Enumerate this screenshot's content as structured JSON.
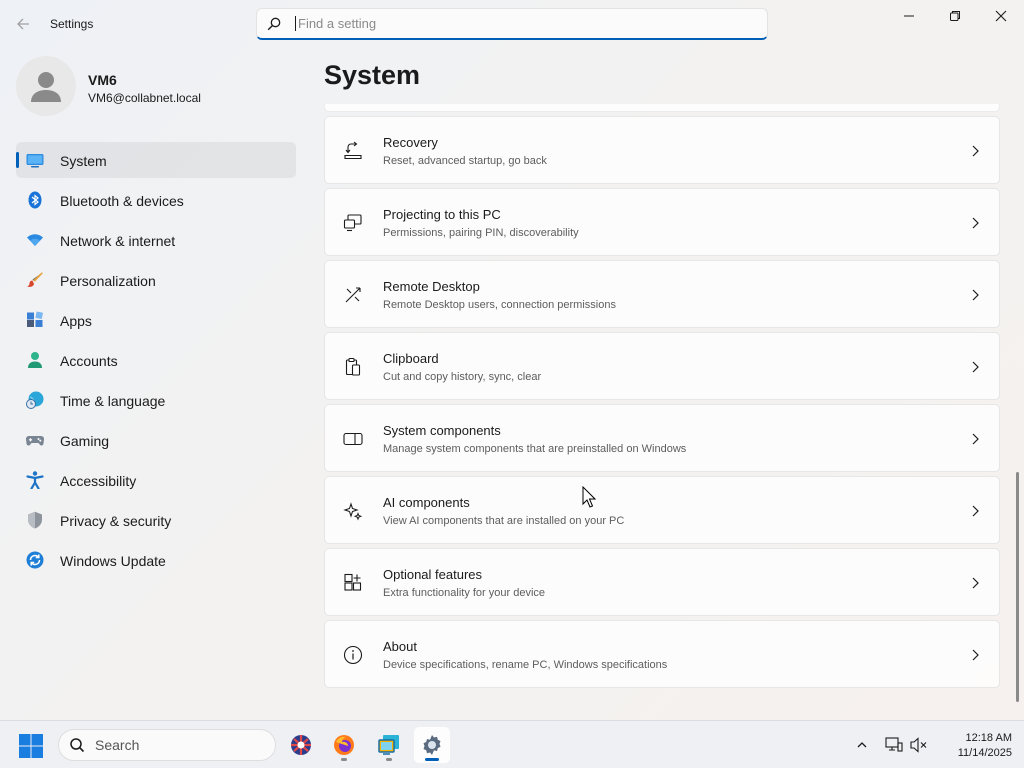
{
  "window": {
    "app_title": "Settings"
  },
  "search": {
    "placeholder": "Find a setting"
  },
  "user": {
    "name": "VM6",
    "email": "VM6@collabnet.local"
  },
  "nav": {
    "items": [
      {
        "label": "System",
        "icon": "system-icon",
        "active": true
      },
      {
        "label": "Bluetooth & devices",
        "icon": "bluetooth-icon"
      },
      {
        "label": "Network & internet",
        "icon": "wifi-icon"
      },
      {
        "label": "Personalization",
        "icon": "brush-icon"
      },
      {
        "label": "Apps",
        "icon": "apps-icon"
      },
      {
        "label": "Accounts",
        "icon": "accounts-icon"
      },
      {
        "label": "Time & language",
        "icon": "globe-clock-icon"
      },
      {
        "label": "Gaming",
        "icon": "gamepad-icon"
      },
      {
        "label": "Accessibility",
        "icon": "accessibility-icon"
      },
      {
        "label": "Privacy & security",
        "icon": "shield-icon"
      },
      {
        "label": "Windows Update",
        "icon": "update-icon"
      }
    ]
  },
  "main": {
    "title": "System",
    "cards": [
      {
        "title": "Recovery",
        "subtitle": "Reset, advanced startup, go back",
        "icon": "recovery-icon"
      },
      {
        "title": "Projecting to this PC",
        "subtitle": "Permissions, pairing PIN, discoverability",
        "icon": "projecting-icon"
      },
      {
        "title": "Remote Desktop",
        "subtitle": "Remote Desktop users, connection permissions",
        "icon": "remote-desktop-icon"
      },
      {
        "title": "Clipboard",
        "subtitle": "Cut and copy history, sync, clear",
        "icon": "clipboard-icon"
      },
      {
        "title": "System components",
        "subtitle": "Manage system components that are preinstalled on Windows",
        "icon": "system-components-icon"
      },
      {
        "title": "AI components",
        "subtitle": "View AI components that are installed on your PC",
        "icon": "sparkle-icon"
      },
      {
        "title": "Optional features",
        "subtitle": "Extra functionality for your device",
        "icon": "optional-features-icon"
      },
      {
        "title": "About",
        "subtitle": "Device specifications, rename PC, Windows specifications",
        "icon": "info-icon"
      }
    ]
  },
  "taskbar": {
    "search_label": "Search",
    "apps": [
      "fluent-app-icon",
      "firefox-icon",
      "remote-desktop-app-icon",
      "settings-app-icon"
    ],
    "time": "12:18 AM",
    "date": "11/14/2025"
  },
  "colors": {
    "accent": "#005fb8"
  }
}
